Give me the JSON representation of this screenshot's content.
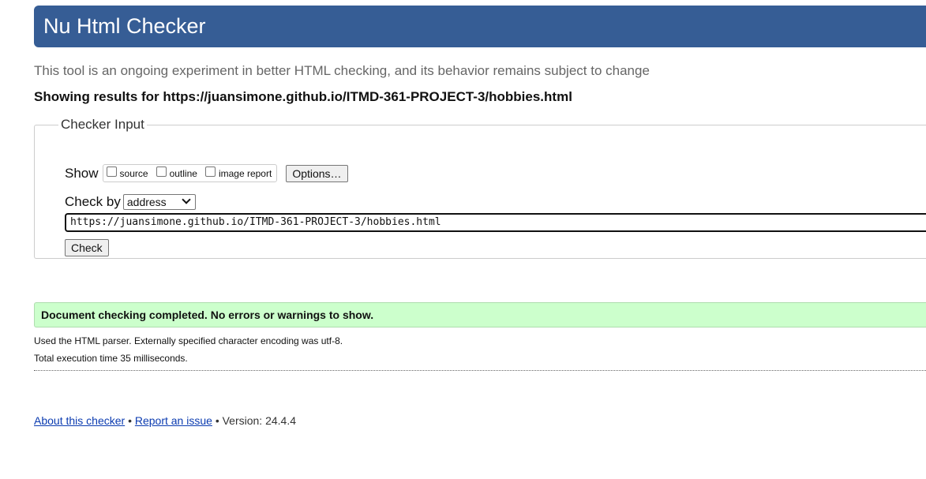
{
  "header": {
    "title": "Nu Html Checker"
  },
  "tagline": "This tool is an ongoing experiment in better HTML checking, and its behavior remains subject to change",
  "results_for": "Showing results for https://juansimone.github.io/ITMD-361-PROJECT-3/hobbies.html",
  "checker_input": {
    "legend": "Checker Input",
    "show_label": "Show",
    "show_options": [
      {
        "label": "source",
        "checked": false
      },
      {
        "label": "outline",
        "checked": false
      },
      {
        "label": "image report",
        "checked": false
      }
    ],
    "options_button": "Options…",
    "check_by_label": "Check by",
    "check_by_selected": "address",
    "url_value": "https://juansimone.github.io/ITMD-361-PROJECT-3/hobbies.html",
    "check_button": "Check"
  },
  "status": {
    "message": "Document checking completed. No errors or warnings to show."
  },
  "details": {
    "parser": "Used the HTML parser. Externally specified character encoding was utf-8.",
    "execution": "Total execution time 35 milliseconds."
  },
  "footer": {
    "about_link": "About this checker",
    "separator": "•",
    "report_link": "Report an issue",
    "version": "Version: 24.4.4"
  },
  "colors": {
    "header_bg": "#365d95",
    "success_bg": "#ccffcc"
  }
}
